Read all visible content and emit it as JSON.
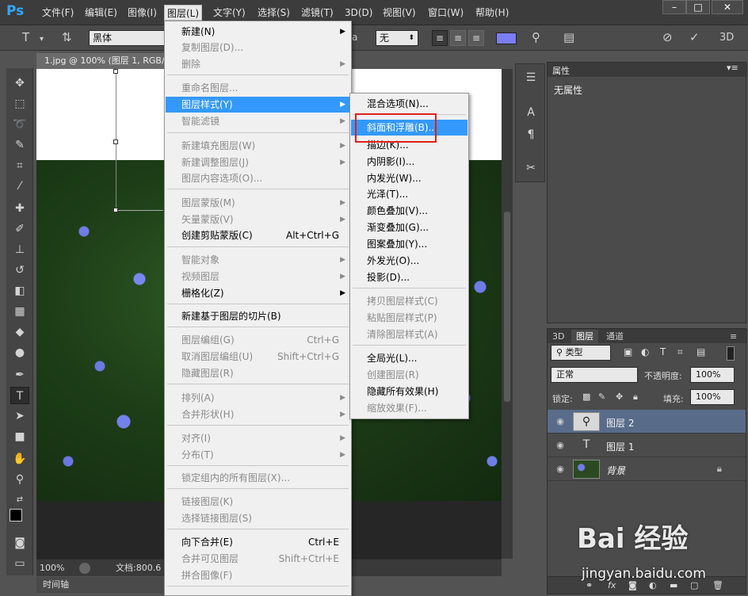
{
  "app": {
    "logo": "Ps"
  },
  "menubar": {
    "items": [
      "文件(F)",
      "编辑(E)",
      "图像(I)",
      "图层(L)",
      "文字(Y)",
      "选择(S)",
      "滤镜(T)",
      "3D(D)",
      "视图(V)",
      "窗口(W)",
      "帮助(H)"
    ],
    "active_index": 3,
    "window_buttons": [
      "–",
      "□",
      "✕"
    ]
  },
  "options_bar": {
    "font_family": "黑体",
    "antialias_prefix": "a",
    "antialias": "无",
    "three_d": "3D"
  },
  "document": {
    "tab_title": "1.jpg @ 100% (图层 1, RGB/",
    "zoom": "100%",
    "doc_info": "文档:800.6",
    "timeline": "时间轴"
  },
  "properties": {
    "tab": "属性",
    "content": "无属性"
  },
  "layers_panel": {
    "tabs": [
      "3D",
      "图层",
      "通道"
    ],
    "active_tab": 1,
    "filter_kind": "类型",
    "blend_mode": "正常",
    "opacity_label": "不透明度:",
    "opacity_value": "100%",
    "lock_label": "锁定:",
    "fill_label": "填充:",
    "fill_value": "100%",
    "layers": [
      {
        "name": "图层 2",
        "type": "text",
        "selected": true
      },
      {
        "name": "图层 1",
        "type": "text",
        "selected": false
      },
      {
        "name": "背景",
        "type": "image",
        "selected": false,
        "locked": true
      }
    ]
  },
  "layer_menu": {
    "items": [
      {
        "label": "新建(N)",
        "submenu": true
      },
      {
        "label": "复制图层(D)...",
        "disabled": true
      },
      {
        "label": "删除",
        "disabled": true,
        "submenu": true
      },
      {
        "label": "重命名图层...",
        "disabled": true
      },
      {
        "label": "图层样式(Y)",
        "submenu": true,
        "highlighted": true
      },
      {
        "label": "智能滤镜",
        "disabled": true,
        "submenu": true
      },
      {
        "label": "新建填充图层(W)",
        "disabled": true,
        "submenu": true
      },
      {
        "label": "新建调整图层(J)",
        "disabled": true,
        "submenu": true
      },
      {
        "label": "图层内容选项(O)...",
        "disabled": true
      },
      {
        "label": "图层蒙版(M)",
        "disabled": true,
        "submenu": true
      },
      {
        "label": "矢量蒙版(V)",
        "disabled": true,
        "submenu": true
      },
      {
        "label": "创建剪贴蒙版(C)",
        "shortcut": "Alt+Ctrl+G"
      },
      {
        "label": "智能对象",
        "disabled": true,
        "submenu": true
      },
      {
        "label": "视频图层",
        "disabled": true,
        "submenu": true
      },
      {
        "label": "栅格化(Z)",
        "submenu": true
      },
      {
        "label": "新建基于图层的切片(B)"
      },
      {
        "label": "图层编组(G)",
        "disabled": true,
        "shortcut": "Ctrl+G"
      },
      {
        "label": "取消图层编组(U)",
        "disabled": true,
        "shortcut": "Shift+Ctrl+G"
      },
      {
        "label": "隐藏图层(R)",
        "disabled": true
      },
      {
        "label": "排列(A)",
        "disabled": true,
        "submenu": true
      },
      {
        "label": "合并形状(H)",
        "disabled": true,
        "submenu": true
      },
      {
        "label": "对齐(I)",
        "disabled": true,
        "submenu": true
      },
      {
        "label": "分布(T)",
        "disabled": true,
        "submenu": true
      },
      {
        "label": "锁定组内的所有图层(X)...",
        "disabled": true
      },
      {
        "label": "链接图层(K)",
        "disabled": true
      },
      {
        "label": "选择链接图层(S)",
        "disabled": true
      },
      {
        "label": "向下合并(E)",
        "shortcut": "Ctrl+E"
      },
      {
        "label": "合并可见图层",
        "disabled": true,
        "shortcut": "Shift+Ctrl+E"
      },
      {
        "label": "拼合图像(F)",
        "disabled": true
      }
    ]
  },
  "layer_style_menu": {
    "items": [
      {
        "label": "混合选项(N)..."
      },
      {
        "label": "斜面和浮雕(B)...",
        "highlighted": true
      },
      {
        "label": "描边(K)..."
      },
      {
        "label": "内阴影(I)..."
      },
      {
        "label": "内发光(W)..."
      },
      {
        "label": "光泽(T)..."
      },
      {
        "label": "颜色叠加(V)..."
      },
      {
        "label": "渐变叠加(G)..."
      },
      {
        "label": "图案叠加(Y)..."
      },
      {
        "label": "外发光(O)..."
      },
      {
        "label": "投影(D)..."
      },
      {
        "label": "拷贝图层样式(C)",
        "disabled": true
      },
      {
        "label": "粘贴图层样式(P)",
        "disabled": true
      },
      {
        "label": "清除图层样式(A)",
        "disabled": true
      },
      {
        "label": "全局光(L)..."
      },
      {
        "label": "创建图层(R)",
        "disabled": true
      },
      {
        "label": "隐藏所有效果(H)"
      },
      {
        "label": "缩放效果(F)...",
        "disabled": true
      }
    ]
  },
  "watermark": {
    "logo": "Bai 经验",
    "url": "jingyan.baidu.com"
  },
  "colors": {
    "menu_highlight": "#3399ff",
    "annotation_box": "#e0201b",
    "selected_layer": "#586c8a"
  }
}
